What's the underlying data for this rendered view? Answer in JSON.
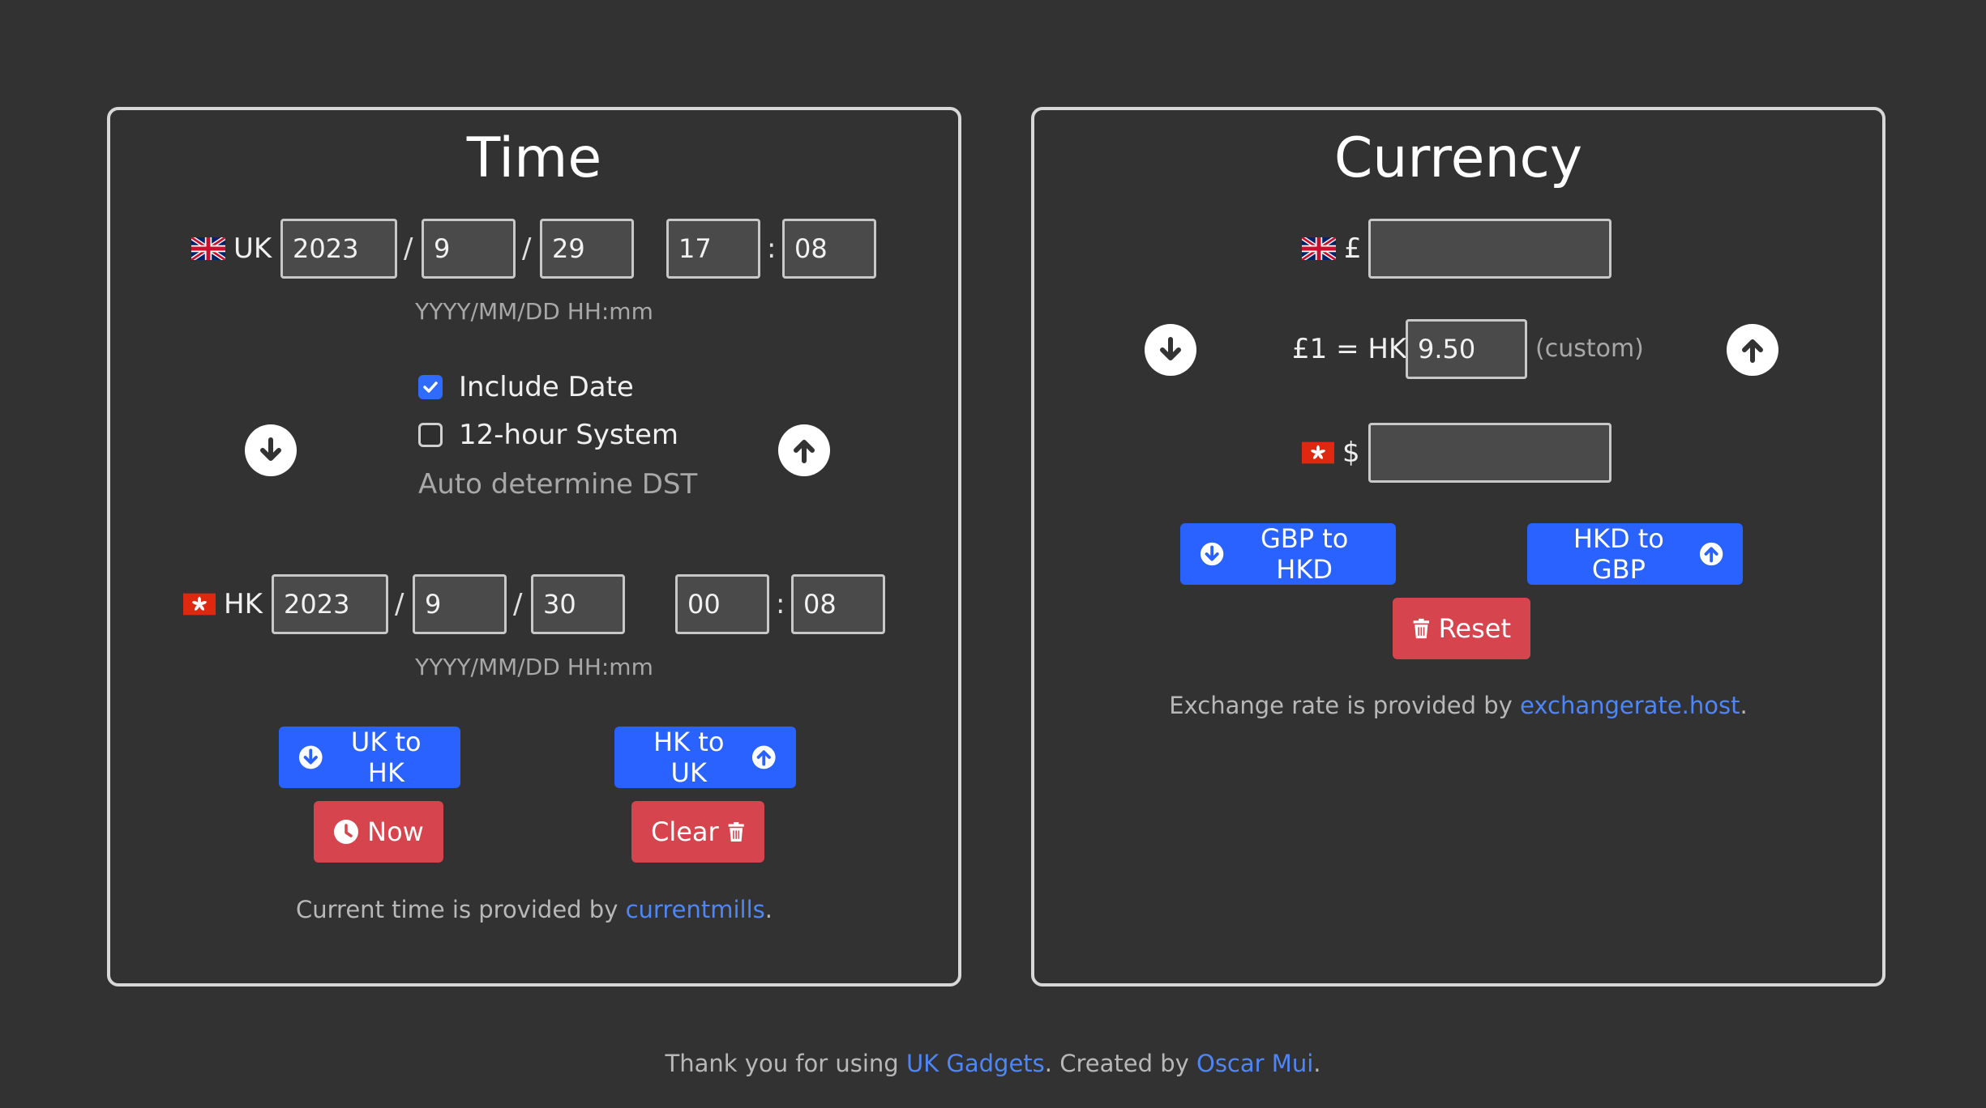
{
  "time": {
    "title": "Time",
    "uk": {
      "label": "UK",
      "year": "2023",
      "month": "9",
      "day": "29",
      "hour": "17",
      "minute": "08",
      "format_hint": "YYYY/MM/DD HH:mm"
    },
    "hk": {
      "label": "HK",
      "year": "2023",
      "month": "9",
      "day": "30",
      "hour": "00",
      "minute": "08",
      "format_hint": "YYYY/MM/DD HH:mm"
    },
    "date_sep": "/",
    "time_sep": ":",
    "options": {
      "include_date": {
        "label": "Include Date",
        "checked": true
      },
      "twelve_hour": {
        "label": "12-hour System",
        "checked": false
      },
      "auto_dst": "Auto determine DST"
    },
    "buttons": {
      "uk_to_hk": "UK to HK",
      "hk_to_uk": "HK to UK",
      "now": "Now",
      "clear": "Clear"
    },
    "credit": {
      "prefix": "Current time is provided by ",
      "link": "currentmills",
      "suffix": "."
    }
  },
  "currency": {
    "title": "Currency",
    "gbp_symbol": "£",
    "hkd_symbol": "$",
    "gbp_value": "",
    "hkd_value": "",
    "rate_label": "£1 = HK$",
    "rate_value": "9.50",
    "rate_note": "(custom)",
    "buttons": {
      "gbp_to_hkd": "GBP to HKD",
      "hkd_to_gbp": "HKD to GBP",
      "reset": "Reset"
    },
    "credit": {
      "prefix": "Exchange rate is provided by ",
      "link": "exchangerate.host",
      "suffix": "."
    }
  },
  "footer": {
    "prefix": "Thank you for using ",
    "app_link": "UK Gadgets",
    "middle": ". Created by ",
    "author_link": "Oscar Mui",
    "suffix": "."
  },
  "colors": {
    "background": "#323232",
    "primary": "#2962ff",
    "danger": "#d6444d",
    "link": "#4f86f7"
  }
}
